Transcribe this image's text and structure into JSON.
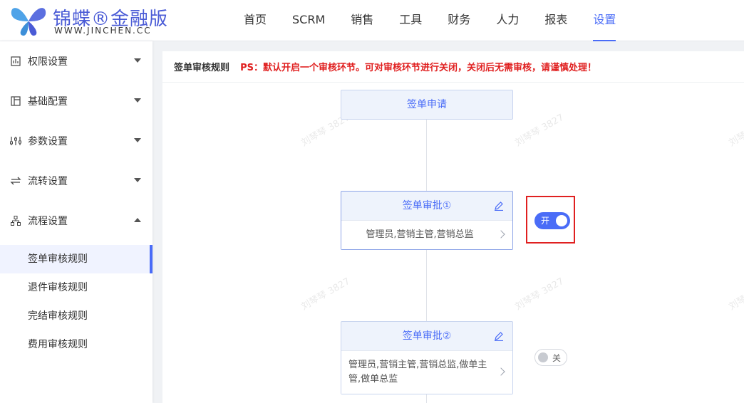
{
  "brand": {
    "name_cn": "锦蝶®金融版",
    "name_en": "WWW.JINCHEN.CC",
    "color_primary": "#4a5bd6"
  },
  "nav": {
    "items": [
      {
        "label": "首页"
      },
      {
        "label": "SCRM"
      },
      {
        "label": "销售"
      },
      {
        "label": "工具"
      },
      {
        "label": "财务"
      },
      {
        "label": "人力"
      },
      {
        "label": "报表"
      },
      {
        "label": "设置",
        "active": true
      }
    ]
  },
  "sidebar": {
    "groups": [
      {
        "label": "权限设置",
        "icon": "permission-icon",
        "expanded": false
      },
      {
        "label": "基础配置",
        "icon": "layout-icon",
        "expanded": false
      },
      {
        "label": "参数设置",
        "icon": "sliders-icon",
        "expanded": false
      },
      {
        "label": "流转设置",
        "icon": "transfer-icon",
        "expanded": false
      },
      {
        "label": "流程设置",
        "icon": "flow-tree-icon",
        "expanded": true
      }
    ],
    "sub_items": [
      {
        "label": "签单审核规则",
        "active": true
      },
      {
        "label": "退件审核规则"
      },
      {
        "label": "完结审核规则"
      },
      {
        "label": "费用审核规则"
      }
    ]
  },
  "main": {
    "title": "签单审核规则",
    "notice": "PS：默认开启一个审核环节。可对审核环节进行关闭，关闭后无需审核，请谨慎处理！",
    "nodes": {
      "start": {
        "label": "签单申请"
      },
      "approval1": {
        "label": "签单审批①",
        "approvers": "管理员,营销主管,营销总监",
        "toggle_label": "开",
        "enabled": true
      },
      "approval2": {
        "label": "签单审批②",
        "approvers": "管理员,营销主管,营销总监,做单主管,做单总监",
        "toggle_label": "关",
        "enabled": false
      }
    },
    "watermark": "刘琴琴 3827"
  },
  "colors": {
    "accent": "#4a6cf7",
    "warning": "#e02020"
  }
}
